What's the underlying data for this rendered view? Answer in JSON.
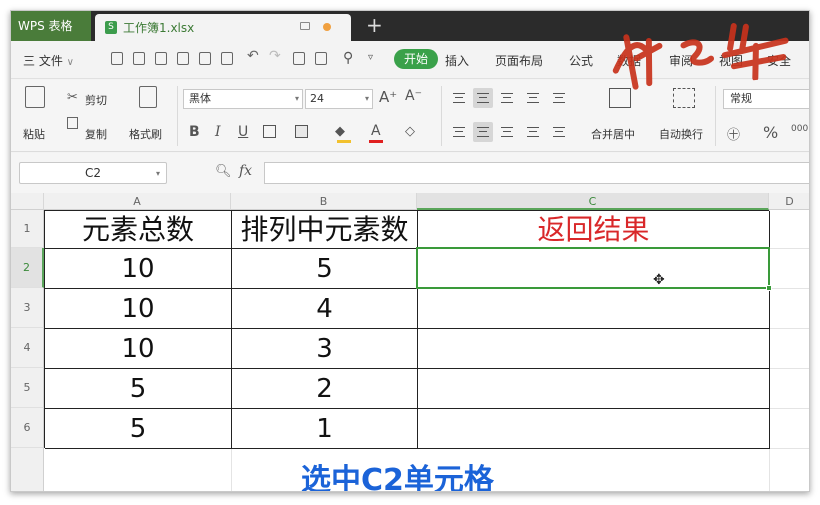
{
  "titlebar": {
    "app_tab": "WPS 表格",
    "doc_tab": "工作簿1.xlsx",
    "doc_icon_letter": "S",
    "new_tab_glyph": "+"
  },
  "menubar": {
    "file_label": "三 文件",
    "file_caret": "∨",
    "start_label": "开始",
    "items": [
      "插入",
      "页面布局",
      "公式",
      "数据",
      "审阅",
      "视图",
      "安全"
    ]
  },
  "ribbon": {
    "paste_label": "粘贴",
    "cut_label": "剪切",
    "copy_label": "复制",
    "format_painter_label": "格式刷",
    "font_name": "黑体",
    "font_size": "24",
    "merge_label": "合并居中",
    "wrap_label": "自动换行",
    "number_format": "常规",
    "bold": "B",
    "italic": "I",
    "underline": "U",
    "grow_font": "A⁺",
    "shrink_font": "A⁻",
    "font_color_glyph": "A",
    "percent_glyph": "%"
  },
  "formula_bar": {
    "name_box": "C2",
    "fx_label": "fx",
    "formula_value": ""
  },
  "sheet": {
    "columns": [
      "A",
      "B",
      "C",
      "D"
    ],
    "rows": [
      "1",
      "2",
      "3",
      "4",
      "5",
      "6"
    ],
    "header_row": [
      "元素总数",
      "排列中元素数",
      "返回结果"
    ],
    "data": [
      [
        "10",
        "5",
        ""
      ],
      [
        "10",
        "4",
        ""
      ],
      [
        "10",
        "3",
        ""
      ],
      [
        "5",
        "2",
        ""
      ],
      [
        "5",
        "1",
        ""
      ]
    ],
    "selected_cell": "C2",
    "selected_column": "C",
    "selected_row": "2"
  },
  "caption": "选中C2单元格",
  "colors": {
    "accent_green": "#3aa14a",
    "result_header_red": "#d9282a",
    "caption_blue": "#1b63d8",
    "selection_green": "#3a9a3a"
  },
  "icons": [
    "paste-icon",
    "cut-icon",
    "copy-icon",
    "format-painter-icon",
    "merge-center-icon",
    "wrap-text-icon",
    "zoom-icon",
    "fx-icon",
    "cross-cursor-icon"
  ]
}
